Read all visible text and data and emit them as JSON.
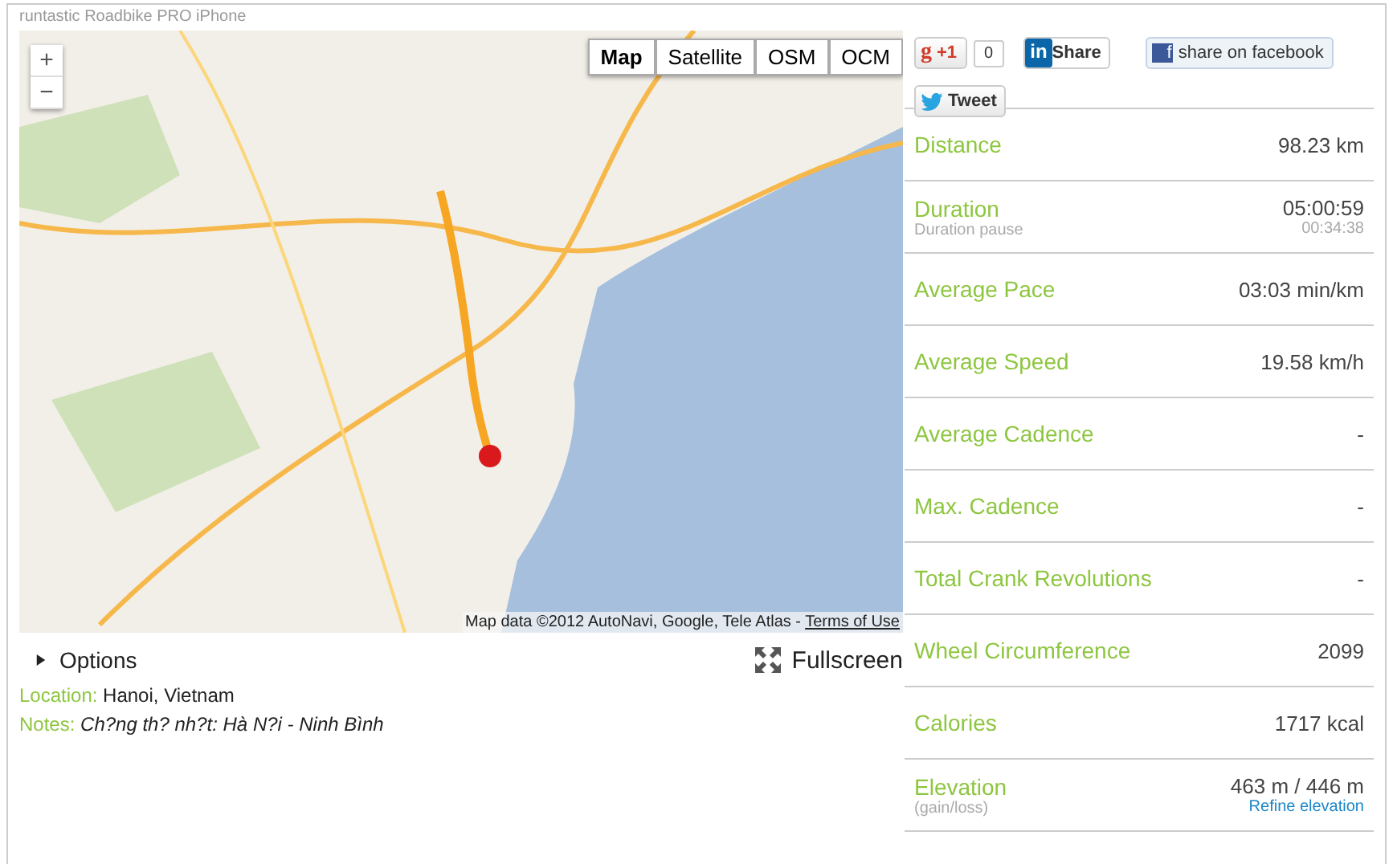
{
  "header": {
    "title": "runtastic Roadbike PRO iPhone"
  },
  "map": {
    "zoom_in": "+",
    "zoom_out": "−",
    "types": [
      {
        "label": "Map",
        "selected": true
      },
      {
        "label": "Satellite",
        "selected": false
      },
      {
        "label": "OSM",
        "selected": false
      },
      {
        "label": "OCM",
        "selected": false
      }
    ],
    "attribution": "Map data ©2012 AutoNavi, Google, Tele Atlas - ",
    "terms_link": "Terms of Use"
  },
  "options": {
    "label": "Options",
    "expanded": false
  },
  "fullscreen": "Fullscreen",
  "location": {
    "label": "Location:",
    "value": "Hanoi, Vietnam"
  },
  "notes": {
    "label": "Notes:",
    "value": "Ch?ng th? nh?t: Hà N?i - Ninh Bình"
  },
  "social": {
    "gplus_icon": "g",
    "linkedin_icon": "in",
    "facebook_icon": "f",
    "gplus": "+1",
    "gplus_count": "0",
    "linkedin": "Share",
    "facebook": "share on facebook",
    "twitter": "Tweet"
  },
  "stats": [
    {
      "label": "Distance",
      "value": "98.23 km"
    },
    {
      "label": "Duration",
      "value": "05:00:59",
      "sublabel": "Duration pause",
      "subvalue": "00:34:38"
    },
    {
      "label": "Average Pace",
      "value": "03:03 min/km"
    },
    {
      "label": "Average Speed",
      "value": "19.58 km/h"
    },
    {
      "label": "Average Cadence",
      "value": "-"
    },
    {
      "label": "Max. Cadence",
      "value": "-"
    },
    {
      "label": "Total Crank Revolutions",
      "value": "-"
    },
    {
      "label": "Wheel Circumference",
      "value": "2099"
    },
    {
      "label": "Calories",
      "value": "1717 kcal"
    },
    {
      "label": "Elevation",
      "value": "463 m / 446 m",
      "sublabel": "(gain/loss)",
      "link": "Refine elevation"
    }
  ]
}
